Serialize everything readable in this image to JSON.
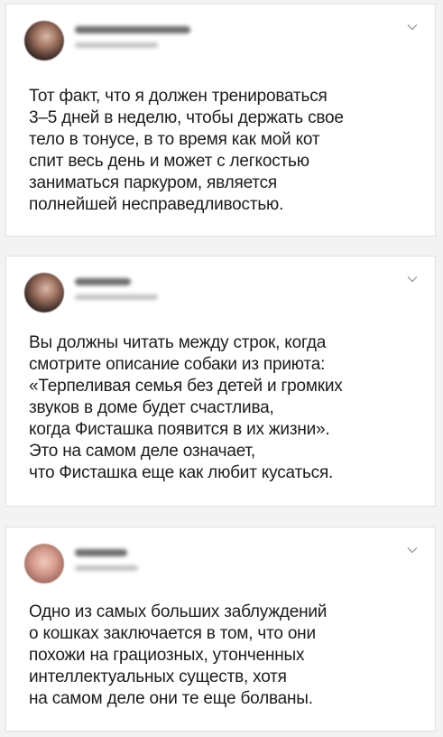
{
  "tweets": [
    {
      "text": "Тот факт, что я должен тренироваться\n3–5 дней в неделю, чтобы держать свое\nтело в тонусе, в то время как мой кот\nспит весь день и может с легкостью\nзаниматься паркуром, является\nполнейшей несправедливостью."
    },
    {
      "text": "Вы должны читать между строк, когда\nсмотрите описание собаки из приюта:\n«Терпеливая семья без детей и громких\nзвуков в доме будет счастлива,\nкогда Фисташка появится в их жизни».\nЭто на самом деле означает,\nчто Фисташка еще как любит кусаться."
    },
    {
      "text": "Одно из самых больших заблуждений\nо кошках заключается в том, что они\nпохожи на грациозных, утонченных\nинтеллектуальных существ, хотя\nна самом деле они те еще болваны."
    }
  ],
  "icons": {
    "avatar": "avatar-blurred",
    "menu": "chevron-down-icon"
  },
  "colors": {
    "background": "#f3f3f3",
    "card": "#ffffff",
    "text": "#1c1c1c",
    "chevron": "#a0a0a0"
  }
}
